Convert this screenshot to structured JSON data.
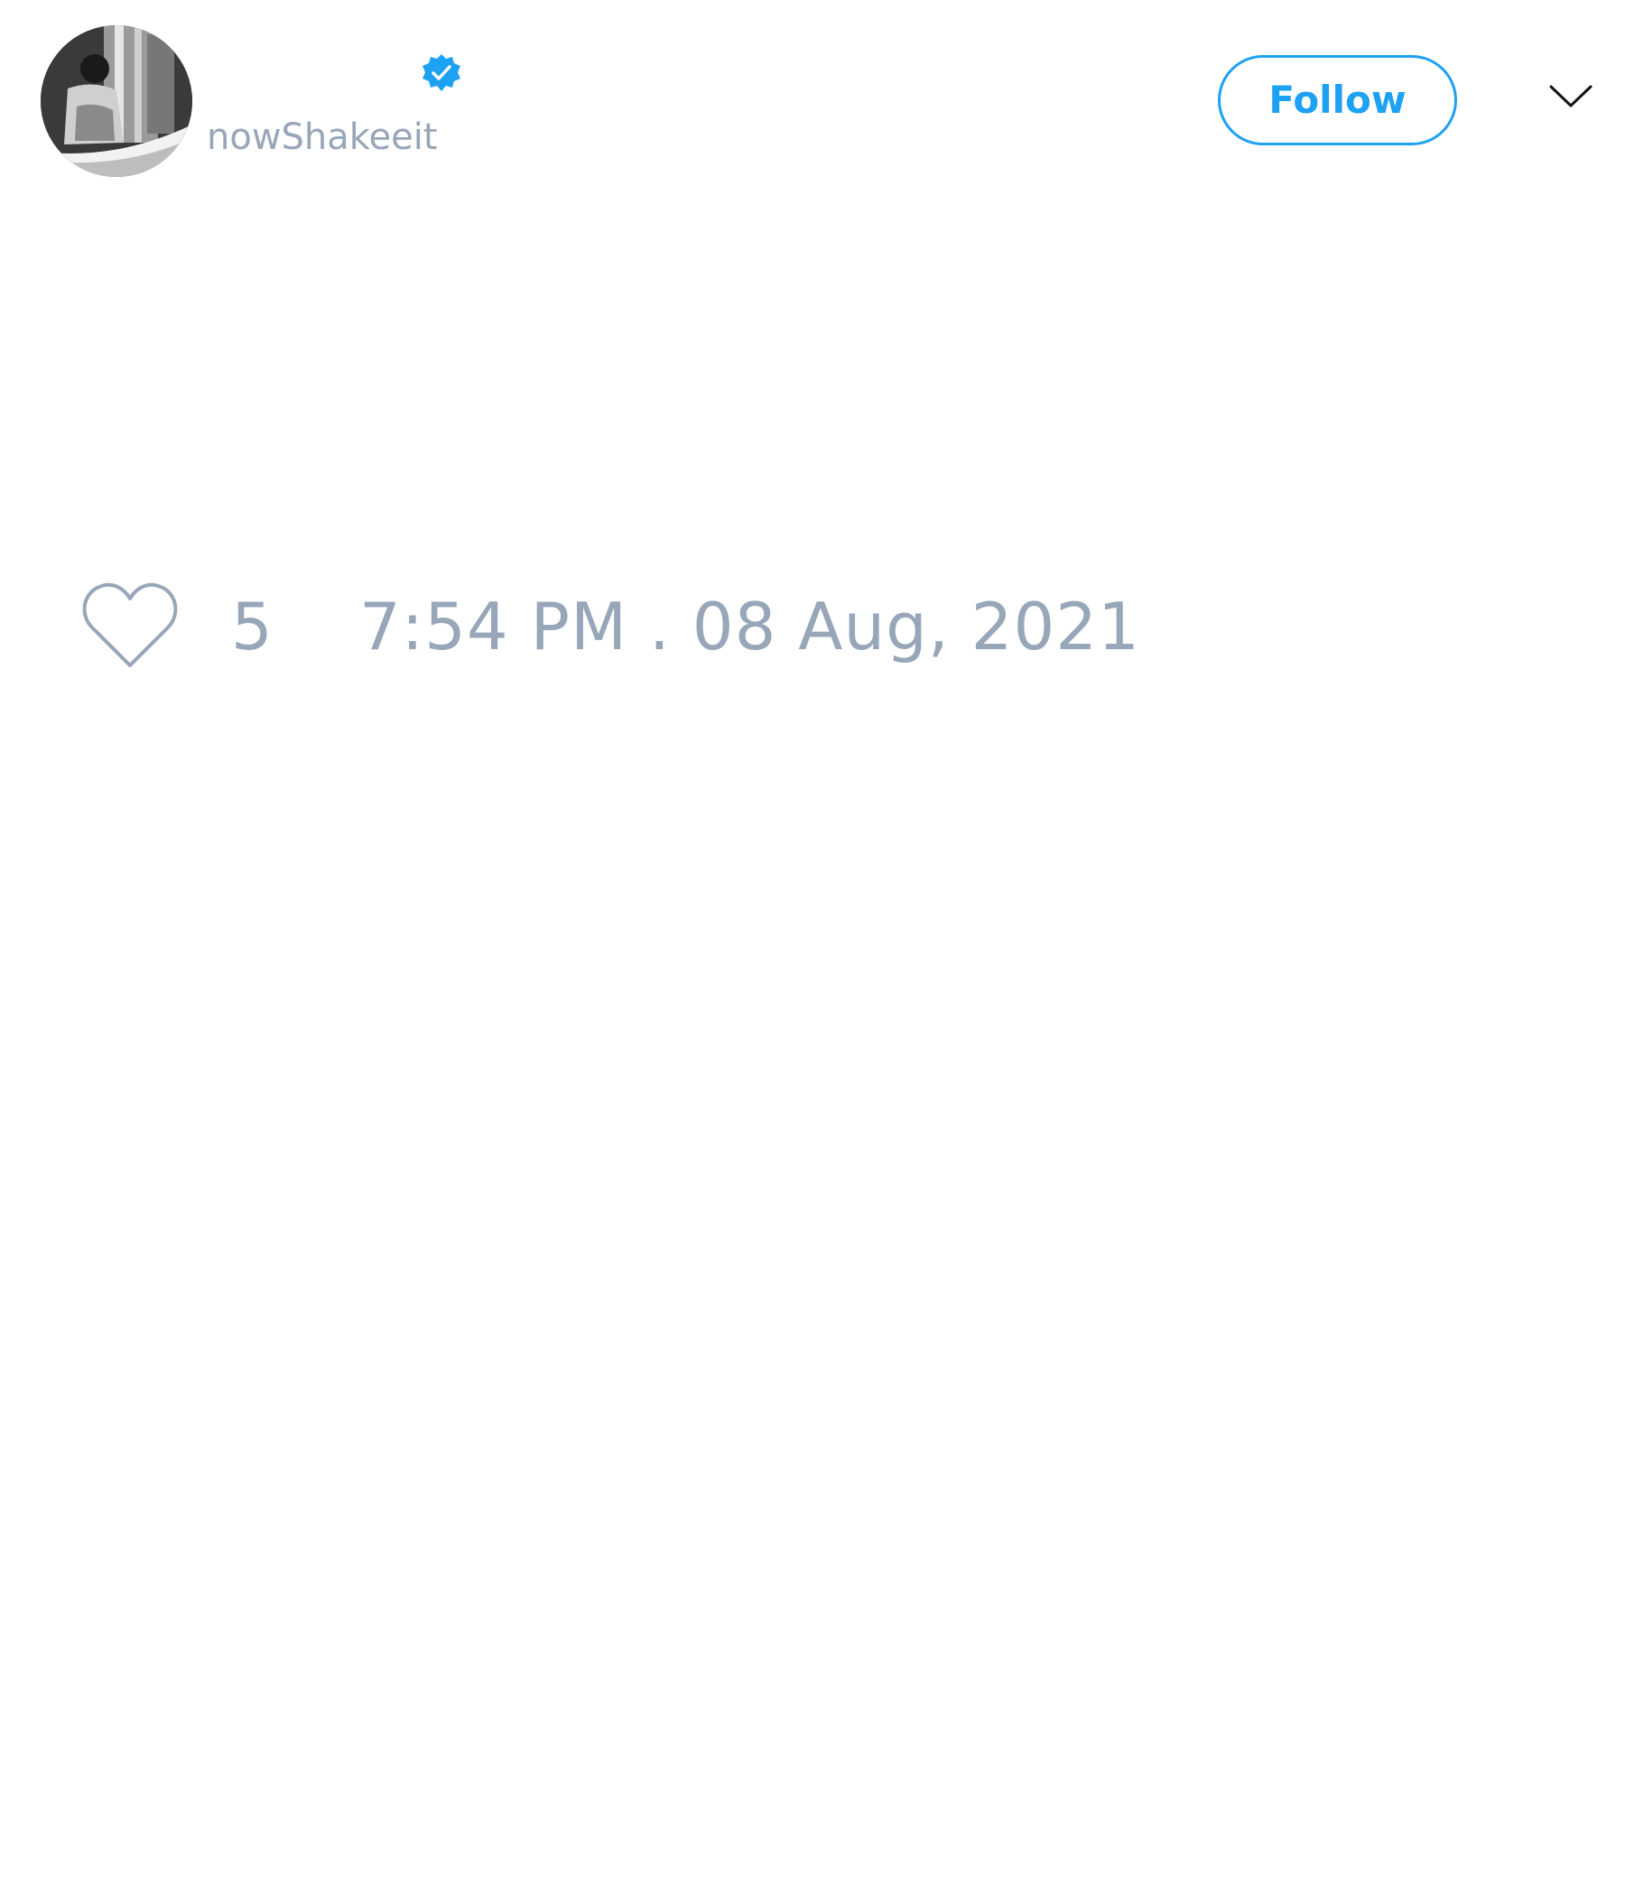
{
  "tweet": {
    "author": {
      "handle": "nowShakeeit",
      "verified": true,
      "avatar_icon": "avatar-photo"
    },
    "follow_label": "Follow",
    "menu_icon": "chevron-down-icon",
    "likes": {
      "icon": "heart-icon",
      "count": "5"
    },
    "timestamp": "7:54 PM . 08 Aug, 2021"
  },
  "colors": {
    "accent": "#1da1f2",
    "muted_text": "#97a6b8",
    "background": "#ffffff"
  }
}
